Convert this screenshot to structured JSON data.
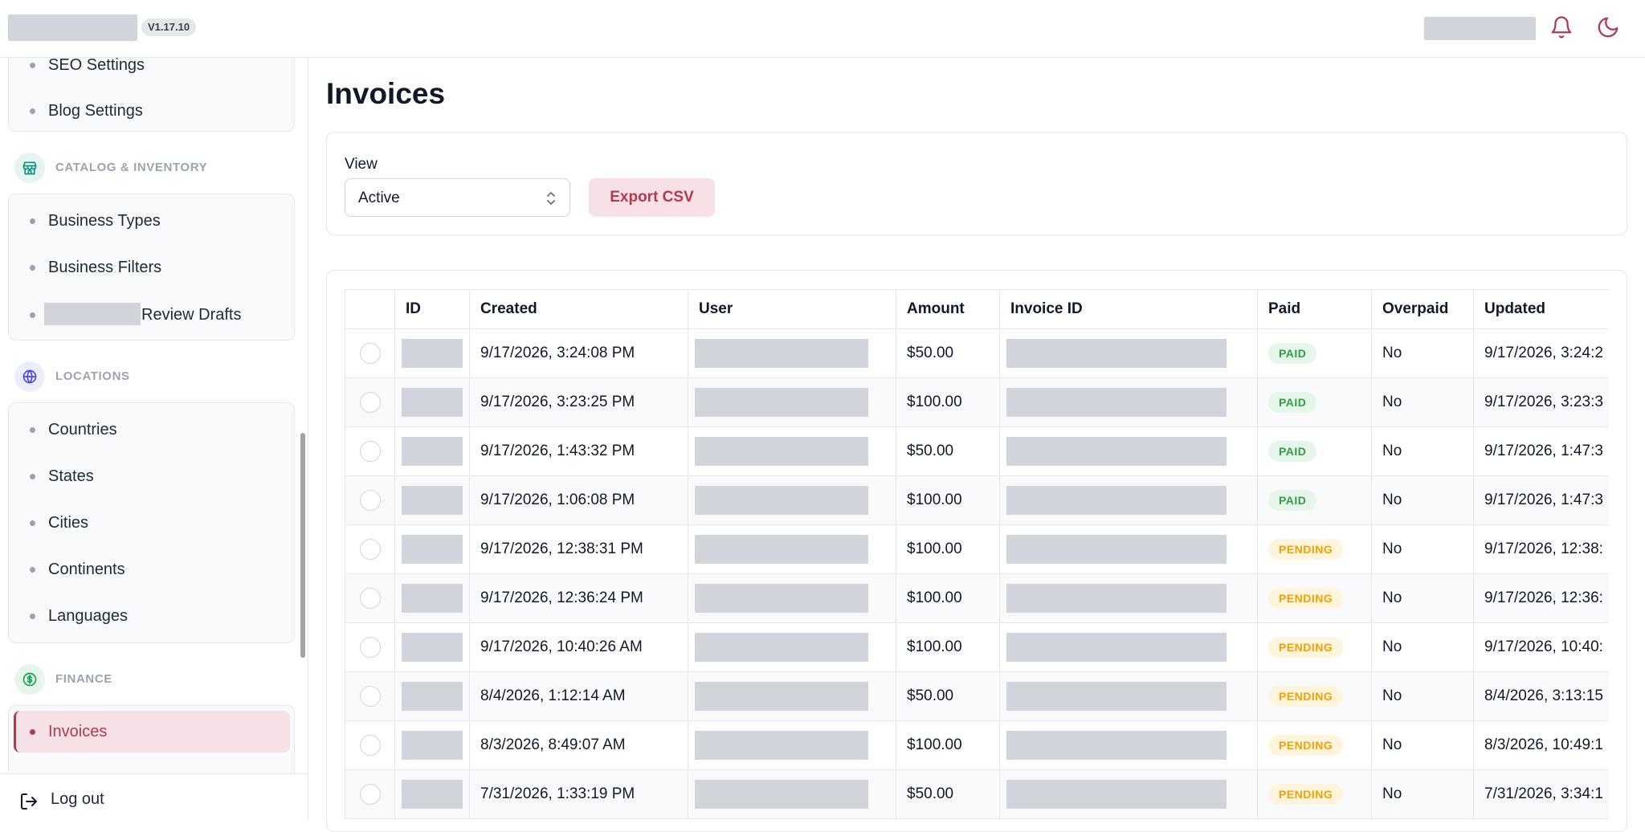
{
  "header": {
    "version": "V1.17.10"
  },
  "sidebar": {
    "settings_items": [
      {
        "label": "SEO Settings"
      },
      {
        "label": "Blog Settings"
      }
    ],
    "sections": [
      {
        "title": "CATALOG & INVENTORY",
        "icon": "store-icon",
        "color": "#0d9488",
        "items": [
          {
            "label": "Business Types"
          },
          {
            "label": "Business Filters"
          },
          {
            "label": "Review Drafts"
          }
        ]
      },
      {
        "title": "LOCATIONS",
        "icon": "globe-icon",
        "color": "#4f46e5",
        "items": [
          {
            "label": "Countries"
          },
          {
            "label": "States"
          },
          {
            "label": "Cities"
          },
          {
            "label": "Continents"
          },
          {
            "label": "Languages"
          }
        ]
      },
      {
        "title": "FINANCE",
        "icon": "dollar-icon",
        "color": "#16a34a",
        "items": [
          {
            "label": "Invoices",
            "active": true
          }
        ]
      }
    ],
    "logout_label": "Log out"
  },
  "main": {
    "title": "Invoices",
    "filter": {
      "view_label": "View",
      "view_value": "Active",
      "export_label": "Export CSV"
    },
    "table": {
      "columns": [
        "",
        "ID",
        "Created",
        "User",
        "Amount",
        "Invoice ID",
        "Paid",
        "Overpaid",
        "Updated"
      ],
      "rows": [
        {
          "created": "9/17/2026, 3:24:08 PM",
          "amount": "$50.00",
          "paid": "PAID",
          "overpaid": "No",
          "updated": "9/17/2026, 3:24:2"
        },
        {
          "created": "9/17/2026, 3:23:25 PM",
          "amount": "$100.00",
          "paid": "PAID",
          "overpaid": "No",
          "updated": "9/17/2026, 3:23:3"
        },
        {
          "created": "9/17/2026, 1:43:32 PM",
          "amount": "$50.00",
          "paid": "PAID",
          "overpaid": "No",
          "updated": "9/17/2026, 1:47:3"
        },
        {
          "created": "9/17/2026, 1:06:08 PM",
          "amount": "$100.00",
          "paid": "PAID",
          "overpaid": "No",
          "updated": "9/17/2026, 1:47:3"
        },
        {
          "created": "9/17/2026, 12:38:31 PM",
          "amount": "$100.00",
          "paid": "PENDING",
          "overpaid": "No",
          "updated": "9/17/2026, 12:38:"
        },
        {
          "created": "9/17/2026, 12:36:24 PM",
          "amount": "$100.00",
          "paid": "PENDING",
          "overpaid": "No",
          "updated": "9/17/2026, 12:36:"
        },
        {
          "created": "9/17/2026, 10:40:26 AM",
          "amount": "$100.00",
          "paid": "PENDING",
          "overpaid": "No",
          "updated": "9/17/2026, 10:40:"
        },
        {
          "created": "8/4/2026, 1:12:14 AM",
          "amount": "$50.00",
          "paid": "PENDING",
          "overpaid": "No",
          "updated": "8/4/2026, 3:13:15"
        },
        {
          "created": "8/3/2026, 8:49:07 AM",
          "amount": "$100.00",
          "paid": "PENDING",
          "overpaid": "No",
          "updated": "8/3/2026, 10:49:1"
        },
        {
          "created": "7/31/2026, 1:33:19 PM",
          "amount": "$50.00",
          "paid": "PENDING",
          "overpaid": "No",
          "updated": "7/31/2026, 3:34:1"
        }
      ]
    }
  }
}
